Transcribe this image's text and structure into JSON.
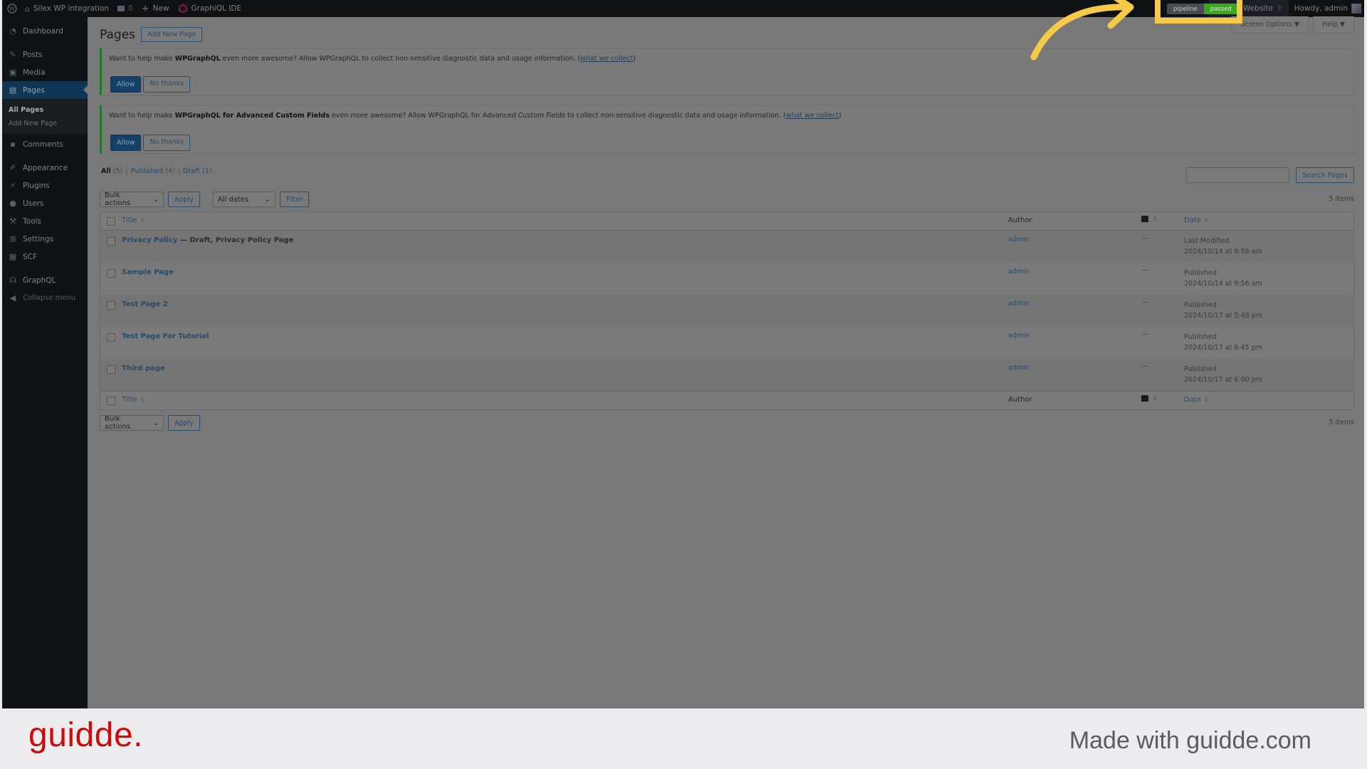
{
  "adminbar": {
    "wp_icon": "wordpress-logo-icon",
    "site_name": "Silex WP integration",
    "comments_count": "0",
    "new_label": "New",
    "graphiql_label": "GraphiQL IDE",
    "pipeline_label": "pipeline",
    "pipeline_status": "passed",
    "deploy_label": "Deploy Website",
    "howdy_label": "Howdy, admin"
  },
  "sidebar": {
    "items": [
      {
        "label": "Dashboard",
        "icon": "dashboard-icon"
      },
      {
        "label": "Posts",
        "icon": "pin-icon"
      },
      {
        "label": "Media",
        "icon": "media-icon"
      },
      {
        "label": "Pages",
        "icon": "pages-icon",
        "active": true
      },
      {
        "label": "Comments",
        "icon": "comment-icon"
      },
      {
        "label": "Appearance",
        "icon": "brush-icon"
      },
      {
        "label": "Plugins",
        "icon": "plugin-icon"
      },
      {
        "label": "Users",
        "icon": "user-icon"
      },
      {
        "label": "Tools",
        "icon": "wrench-icon"
      },
      {
        "label": "Settings",
        "icon": "settings-icon"
      },
      {
        "label": "SCF",
        "icon": "grid-icon"
      },
      {
        "label": "GraphQL",
        "icon": "graphql-icon"
      },
      {
        "label": "Collapse menu",
        "icon": "collapse-icon"
      }
    ],
    "submenu": [
      "All Pages",
      "Add New Page"
    ]
  },
  "header": {
    "title": "Pages",
    "add_new": "Add New Page",
    "screen_options": "Screen Options ▼",
    "help": "Help ▼"
  },
  "notices": [
    {
      "prefix": "Want to help make ",
      "bold": "WPGraphQL",
      "suffix": " even more awesome? Allow WPGraphQL to collect non-sensitive diagnostic data and usage information. (",
      "link": "what we collect",
      "end": ")",
      "allow": "Allow",
      "no_thanks": "No thanks"
    },
    {
      "prefix": "Want to help make ",
      "bold": "WPGraphQL for Advanced Custom Fields",
      "suffix": " even more awesome? Allow WPGraphQL for Advanced Custom Fields to collect non-sensitive diagnostic data and usage information. (",
      "link": "what we collect",
      "end": ")",
      "allow": "Allow",
      "no_thanks": "No thanks"
    }
  ],
  "views": {
    "all": "All",
    "all_count": "(5)",
    "published": "Published",
    "published_count": "(4)",
    "draft": "Draft",
    "draft_count": "(1)"
  },
  "search": {
    "value": "",
    "button": "Search Pages"
  },
  "toolbar": {
    "bulk_actions": "Bulk actions",
    "apply": "Apply",
    "all_dates": "All dates",
    "filter": "Filter",
    "items_count": "5 items"
  },
  "table": {
    "columns": {
      "title": "Title",
      "author": "Author",
      "comments": "comment-icon",
      "date": "Date"
    },
    "rows": [
      {
        "title": "Privacy Policy",
        "state": " — Draft, Privacy Policy Page",
        "author": "admin",
        "comments": "—",
        "date_status": "Last Modified",
        "date": "2024/10/14 at 9:56 am"
      },
      {
        "title": "Sample Page",
        "state": "",
        "author": "admin",
        "comments": "—",
        "date_status": "Published",
        "date": "2024/10/14 at 9:56 am"
      },
      {
        "title": "Test Page 2",
        "state": "",
        "author": "admin",
        "comments": "—",
        "date_status": "Published",
        "date": "2024/10/17 at 5:48 pm"
      },
      {
        "title": "Test Page For Tutorial",
        "state": "",
        "author": "admin",
        "comments": "—",
        "date_status": "Published",
        "date": "2024/10/17 at 6:45 pm"
      },
      {
        "title": "Third page",
        "state": "",
        "author": "admin",
        "comments": "—",
        "date_status": "Published",
        "date": "2024/10/17 at 6:00 pm"
      }
    ]
  },
  "footer": {
    "logo": "guidde.",
    "made_with": "Made with guidde.com"
  },
  "colors": {
    "highlight": "#f7c948",
    "brand_red": "#cc0b0b",
    "pipeline_passed": "#3aa81c"
  }
}
